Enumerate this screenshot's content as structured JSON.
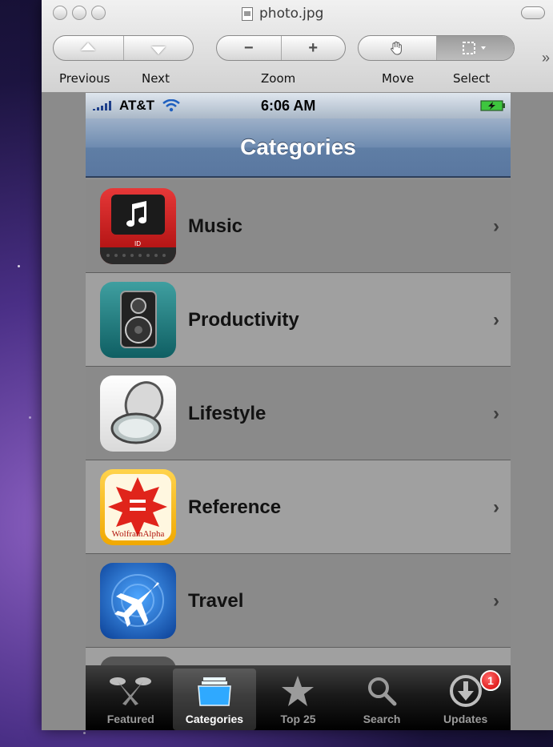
{
  "window": {
    "title": "photo.jpg",
    "toolbar": {
      "previous_label": "Previous",
      "next_label": "Next",
      "zoom_label": "Zoom",
      "move_label": "Move",
      "select_label": "Select",
      "zoom_out_glyph": "−",
      "zoom_in_glyph": "+",
      "overflow_glyph": "»"
    }
  },
  "statusbar": {
    "carrier": "AT&T",
    "time": "6:06 AM"
  },
  "navbar": {
    "title": "Categories"
  },
  "categories": [
    {
      "label": "Music",
      "icon": "music-app-icon"
    },
    {
      "label": "Productivity",
      "icon": "speaker-app-icon"
    },
    {
      "label": "Lifestyle",
      "icon": "mirror-compact-icon"
    },
    {
      "label": "Reference",
      "icon": "wolfram-alpha-icon",
      "icon_text": "WolframAlpha"
    },
    {
      "label": "Travel",
      "icon": "airplane-icon"
    }
  ],
  "tabbar": {
    "tabs": [
      {
        "label": "Featured",
        "icon": "featured-icon",
        "selected": false
      },
      {
        "label": "Categories",
        "icon": "categories-icon",
        "selected": true
      },
      {
        "label": "Top 25",
        "icon": "star-icon",
        "selected": false
      },
      {
        "label": "Search",
        "icon": "search-icon",
        "selected": false
      },
      {
        "label": "Updates",
        "icon": "updates-icon",
        "selected": false,
        "badge": "1"
      }
    ]
  },
  "colors": {
    "navbar": "#6e8bb0",
    "badge": "#d40000",
    "battery": "#3ec63e"
  }
}
